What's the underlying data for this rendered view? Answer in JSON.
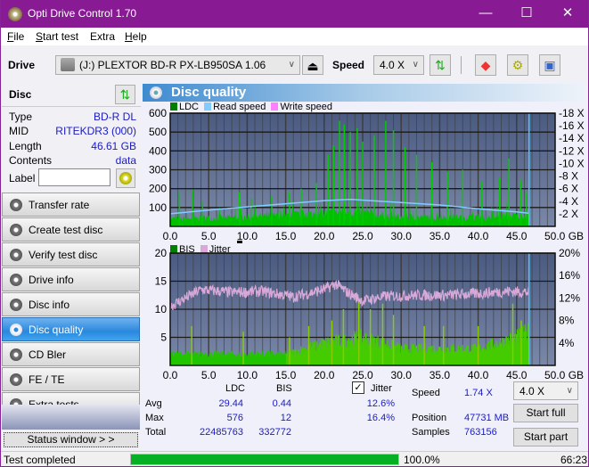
{
  "window": {
    "title": "Opti Drive Control 1.70",
    "minimize": "—",
    "maximize": "☐",
    "close": "✕"
  },
  "menu": [
    {
      "label": "File",
      "ul": "F",
      "rest": "ile"
    },
    {
      "label": "Start test",
      "ul": "S",
      "rest": "tart test"
    },
    {
      "label": "Extra",
      "ul": "",
      "rest": "Extra"
    },
    {
      "label": "Help",
      "ul": "H",
      "rest": "elp"
    }
  ],
  "toolbar": {
    "drive_label": "Drive",
    "drive_value": "(J:)  PLEXTOR BD-R  PX-LB950SA 1.06",
    "speed_label": "Speed",
    "speed_value": "4.0 X",
    "icons": [
      "eject-icon",
      "swap-icon",
      "eraser-icon",
      "settings-icon",
      "save-icon"
    ]
  },
  "disc": {
    "header": "Disc",
    "rows": [
      {
        "key": "Type",
        "value": "BD-R DL"
      },
      {
        "key": "MID",
        "value": "RITEKDR3 (000)"
      },
      {
        "key": "Length",
        "value": "46.61 GB"
      },
      {
        "key": "Contents",
        "value": "data"
      }
    ],
    "label_key": "Label",
    "label_value": ""
  },
  "nav": [
    {
      "label": "Transfer rate",
      "active": false
    },
    {
      "label": "Create test disc",
      "active": false
    },
    {
      "label": "Verify test disc",
      "active": false
    },
    {
      "label": "Drive info",
      "active": false
    },
    {
      "label": "Disc info",
      "active": false
    },
    {
      "label": "Disc quality",
      "active": true
    },
    {
      "label": "CD Bler",
      "active": false
    },
    {
      "label": "FE / TE",
      "active": false
    },
    {
      "label": "Extra tests",
      "active": false
    }
  ],
  "status_window_btn": "Status window > >",
  "panel_title": "Disc quality",
  "chart_data": [
    {
      "type": "bar",
      "title": "LDC",
      "legend": [
        {
          "name": "LDC",
          "color": "#008000"
        },
        {
          "name": "Read speed",
          "color": "#80ccff"
        },
        {
          "name": "Write speed",
          "color": "#ff80ff"
        }
      ],
      "xlabel": "GB",
      "xlim": [
        0,
        50
      ],
      "xticks": [
        "0.0",
        "5.0",
        "10.0",
        "15.0",
        "20.0",
        "25.0",
        "30.0",
        "35.0",
        "40.0",
        "45.0",
        "50.0 GB"
      ],
      "ylim": [
        0,
        600
      ],
      "yticks": [
        "100",
        "200",
        "300",
        "400",
        "500",
        "600"
      ],
      "y2ticks": [
        "2 X",
        "4 X",
        "6 X",
        "8 X",
        "10 X",
        "12 X",
        "14 X",
        "16 X",
        "18 X"
      ],
      "y2lim": [
        0,
        18
      ],
      "data_end_gb": 46.61,
      "ldc_base_profile": [
        [
          0,
          40
        ],
        [
          10,
          50
        ],
        [
          20,
          70
        ],
        [
          23,
          80
        ],
        [
          30,
          50
        ],
        [
          40,
          50
        ],
        [
          46.6,
          60
        ]
      ],
      "ldc_spikes": [
        [
          1.2,
          185
        ],
        [
          2.9,
          195
        ],
        [
          4.2,
          130
        ],
        [
          9.0,
          180
        ],
        [
          10.5,
          150
        ],
        [
          13.2,
          160
        ],
        [
          15.5,
          180
        ],
        [
          17,
          200
        ],
        [
          19,
          230
        ],
        [
          20.5,
          380
        ],
        [
          21.2,
          430
        ],
        [
          22,
          560
        ],
        [
          22.6,
          540
        ],
        [
          23.4,
          500
        ],
        [
          24.3,
          520
        ],
        [
          25,
          450
        ],
        [
          26.5,
          480
        ],
        [
          28,
          560
        ],
        [
          29,
          510
        ],
        [
          30.5,
          420
        ],
        [
          32,
          380
        ],
        [
          34,
          340
        ],
        [
          36,
          290
        ],
        [
          38,
          300
        ],
        [
          40.5,
          240
        ],
        [
          42.8,
          260
        ],
        [
          44,
          360
        ],
        [
          45.5,
          250
        ],
        [
          46.3,
          180
        ]
      ],
      "read_speed_x": [
        [
          0,
          2.0
        ],
        [
          5,
          2.6
        ],
        [
          10,
          3.1
        ],
        [
          15,
          3.6
        ],
        [
          20,
          4.1
        ],
        [
          23.5,
          4.3
        ],
        [
          30,
          3.8
        ],
        [
          35,
          3.4
        ],
        [
          40,
          2.8
        ],
        [
          45,
          2.3
        ],
        [
          46.6,
          2.1
        ]
      ]
    },
    {
      "type": "bar",
      "title": "BIS",
      "legend": [
        {
          "name": "BIS",
          "color": "#008000"
        },
        {
          "name": "Jitter",
          "color": "#d89ed8"
        }
      ],
      "xlabel": "GB",
      "xlim": [
        0,
        50
      ],
      "xticks": [
        "0.0",
        "5.0",
        "10.0",
        "15.0",
        "20.0",
        "25.0",
        "30.0",
        "35.0",
        "40.0",
        "45.0",
        "50.0 GB"
      ],
      "ylim": [
        0,
        20
      ],
      "yticks": [
        "5",
        "10",
        "15",
        "20"
      ],
      "y2ticks": [
        "4%",
        "8%",
        "12%",
        "16%",
        "20%"
      ],
      "y2lim": [
        0,
        20
      ],
      "data_end_gb": 46.61,
      "bis_base_profile": [
        [
          0,
          2
        ],
        [
          15,
          2
        ],
        [
          20,
          4
        ],
        [
          25,
          5
        ],
        [
          30,
          3
        ],
        [
          40,
          3
        ],
        [
          45,
          5
        ],
        [
          46.6,
          6
        ]
      ],
      "bis_spikes": [
        [
          2.8,
          7
        ],
        [
          9.5,
          6
        ],
        [
          15.5,
          5
        ],
        [
          18,
          7
        ],
        [
          21,
          8
        ],
        [
          22.5,
          10
        ],
        [
          24.5,
          12
        ],
        [
          26,
          10
        ],
        [
          27.6,
          11
        ],
        [
          29,
          9
        ],
        [
          33,
          7
        ],
        [
          35.5,
          7
        ],
        [
          40,
          7
        ],
        [
          44.5,
          11
        ],
        [
          45.6,
          8
        ]
      ],
      "jitter_percent": [
        [
          0,
          10.5
        ],
        [
          2,
          12
        ],
        [
          4,
          13.5
        ],
        [
          8,
          13
        ],
        [
          12,
          13.2
        ],
        [
          16,
          12.2
        ],
        [
          20,
          13.5
        ],
        [
          21.5,
          14.5
        ],
        [
          23,
          13
        ],
        [
          25,
          11.5
        ],
        [
          28,
          12.3
        ],
        [
          32,
          12.5
        ],
        [
          36,
          12.5
        ],
        [
          40,
          12.8
        ],
        [
          44,
          13.2
        ],
        [
          46.6,
          13
        ]
      ]
    }
  ],
  "stats": {
    "col_ldc": "LDC",
    "col_bis": "BIS",
    "jitter_checked": true,
    "jitter_label": "Jitter",
    "rows": [
      {
        "label": "Avg",
        "ldc": "29.44",
        "bis": "0.44",
        "jitter": "12.6%"
      },
      {
        "label": "Max",
        "ldc": "576",
        "bis": "12",
        "jitter": "16.4%"
      },
      {
        "label": "Total",
        "ldc": "22485763",
        "bis": "332772",
        "jitter": ""
      }
    ],
    "speed_label": "Speed",
    "speed_value": "1.74 X",
    "position_label": "Position",
    "position_value": "47731 MB",
    "samples_label": "Samples",
    "samples_value": "763156",
    "speed_select": "4.0 X",
    "start_full": "Start full",
    "start_part": "Start part"
  },
  "status": {
    "text": "Test completed",
    "progress": 1.0,
    "percent": "100.0%",
    "time": "66:23"
  }
}
